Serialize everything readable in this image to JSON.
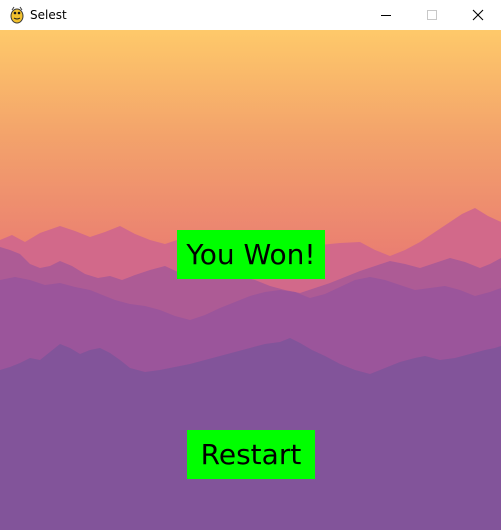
{
  "window": {
    "title": "Selest",
    "icon": "pygame-snake-icon"
  },
  "controls": {
    "minimize_icon": "minimize-icon",
    "maximize_icon": "maximize-icon",
    "close_icon": "close-icon"
  },
  "game": {
    "message": "You Won!",
    "restart_label": "Restart",
    "colors": {
      "sky_top": "#fec96a",
      "sky_bottom": "#e97a72",
      "far_mountains": "#d2698a",
      "mid_mountains": "#ad5b95",
      "near_mountains": "#9b559b",
      "front_mountains": "#82549a",
      "button_bg": "#00ff00",
      "button_text": "#000000"
    }
  }
}
